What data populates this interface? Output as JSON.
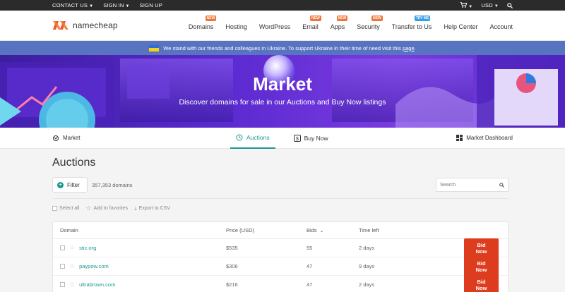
{
  "topbar": {
    "contact": "CONTACT US",
    "signin": "SIGN IN",
    "signup": "SIGN UP",
    "currency": "USD"
  },
  "header": {
    "logo_text": "namecheap",
    "nav": [
      {
        "label": "Domains",
        "badge": "NEW",
        "badge_color": "#f0753a"
      },
      {
        "label": "Hosting",
        "badge": "",
        "badge_color": ""
      },
      {
        "label": "WordPress",
        "badge": "",
        "badge_color": ""
      },
      {
        "label": "Email",
        "badge": "NEW",
        "badge_color": "#f0753a"
      },
      {
        "label": "Apps",
        "badge": "NEW",
        "badge_color": "#f0753a"
      },
      {
        "label": "Security",
        "badge": "NEW",
        "badge_color": "#f0753a"
      },
      {
        "label": "Transfer to Us",
        "badge": "TRY ME",
        "badge_color": "#3aa0e6"
      },
      {
        "label": "Help Center",
        "badge": "",
        "badge_color": ""
      },
      {
        "label": "Account",
        "badge": "",
        "badge_color": ""
      }
    ]
  },
  "ukraine": {
    "text": "We stand with our friends and colleagues in Ukraine. To support Ukraine in their time of need visit this",
    "link": "page",
    "end": "."
  },
  "hero": {
    "title": "Market",
    "subtitle": "Discover domains for sale in our Auctions and Buy Now listings"
  },
  "subnav": {
    "market": "Market",
    "auctions": "Auctions",
    "buynow": "Buy Now",
    "dashboard": "Market Dashboard"
  },
  "main": {
    "title": "Auctions",
    "filter_label": "Filter",
    "domain_count": "357,353 domains",
    "search_placeholder": "Search",
    "select_all": "Select all",
    "add_favorites": "Add to favorites",
    "export": "Export to CSV"
  },
  "table": {
    "headers": {
      "domain": "Domain",
      "price": "Price (USD)",
      "bids": "Bids",
      "time": "Time left"
    },
    "rows": [
      {
        "domain": "stic.org",
        "price": "$535",
        "bids": "55",
        "time": "2 days",
        "action": "Bid Now"
      },
      {
        "domain": "paypow.com",
        "price": "$306",
        "bids": "47",
        "time": "9 days",
        "action": "Bid Now"
      },
      {
        "domain": "ultrabrown.com",
        "price": "$216",
        "bids": "47",
        "time": "2 days",
        "action": "Bid Now"
      }
    ]
  },
  "colors": {
    "accent": "#1a9a8f",
    "bid": "#de3c1f",
    "brand": "#ff5a2c",
    "banner": "#5874c1"
  }
}
